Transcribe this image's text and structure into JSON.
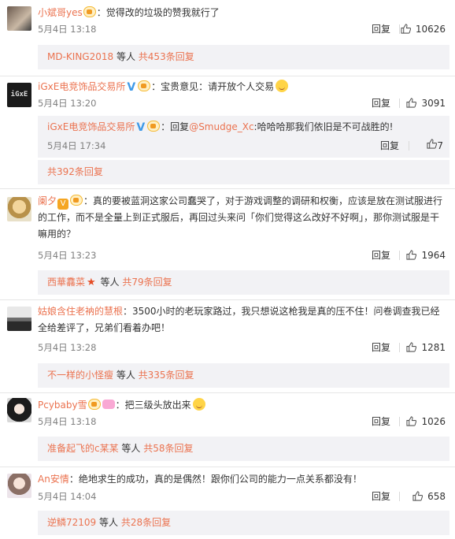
{
  "comments": [
    {
      "user": "小斌哥yes",
      "text": "：觉得改的垃圾的赞我就行了",
      "time": "5月4日 13:18",
      "reply": "回复",
      "likes": "10626",
      "more": {
        "user": "MD-KING2018",
        "mid": " 等人 ",
        "count": "共453条回复"
      }
    },
    {
      "user": "iGxE电竞饰品交易所",
      "text": "：宝贵意见：请开放个人交易",
      "time": "5月4日 13:20",
      "reply": "回复",
      "likes": "3091",
      "subreply": {
        "user": "iGxE电竞饰品交易所",
        "prefix": "：回复",
        "mention": "@Smudge_Xc",
        "text": ":哈哈哈那我们依旧是不可战胜的!",
        "time": "5月4日 17:34",
        "reply": "回复",
        "likes": "7"
      },
      "more": {
        "count": "共392条回复"
      }
    },
    {
      "user": "阑夕",
      "text": "：真的要被蓝洞这家公司蠢哭了，对于游戏调整的调研和权衡，应该是放在测试服进行的工作，而不是全量上到正式服后，再回过头来问「你们觉得这么改好不好啊」，那你测试服是干嘛用的？",
      "time": "5月4日 13:23",
      "reply": "回复",
      "likes": "1964",
      "more": {
        "user": "西華馫菜",
        "mid": " 等人 ",
        "count": "共79条回复"
      }
    },
    {
      "user": "姑娘含住老衲的慧根",
      "text": "：3500小时的老玩家路过，我只想说这枪我是真的压不住！问卷调查我已经全给差评了，兄弟们看着办吧！",
      "time": "5月4日 13:28",
      "reply": "回复",
      "likes": "1281",
      "more": {
        "user": "不一样的小怪瘦",
        "mid": " 等人 ",
        "count": "共335条回复"
      }
    },
    {
      "user": "Pcybaby雪",
      "text": "：把三级头放出来",
      "time": "5月4日 13:18",
      "reply": "回复",
      "likes": "1026",
      "more": {
        "user": "准备起飞的c某某",
        "mid": " 等人 ",
        "count": "共58条回复"
      }
    },
    {
      "user": "An安情",
      "text": "：绝地求生的成功，真的是偶然！跟你们公司的能力一点关系都没有！",
      "time": "5月4日 14:04",
      "reply": "回复",
      "likes": "658",
      "more": {
        "user": "逆鳞72109",
        "mid": " 等人 ",
        "count": "共28条回复"
      }
    }
  ],
  "colors": {
    "link": "#eb7350",
    "subbg": "#f2f2f5",
    "verified": "#3f9ae8"
  },
  "icons": {
    "like": "thumbs-up-icon",
    "vip": "vip-badge-icon",
    "verified": "verified-v-icon"
  }
}
